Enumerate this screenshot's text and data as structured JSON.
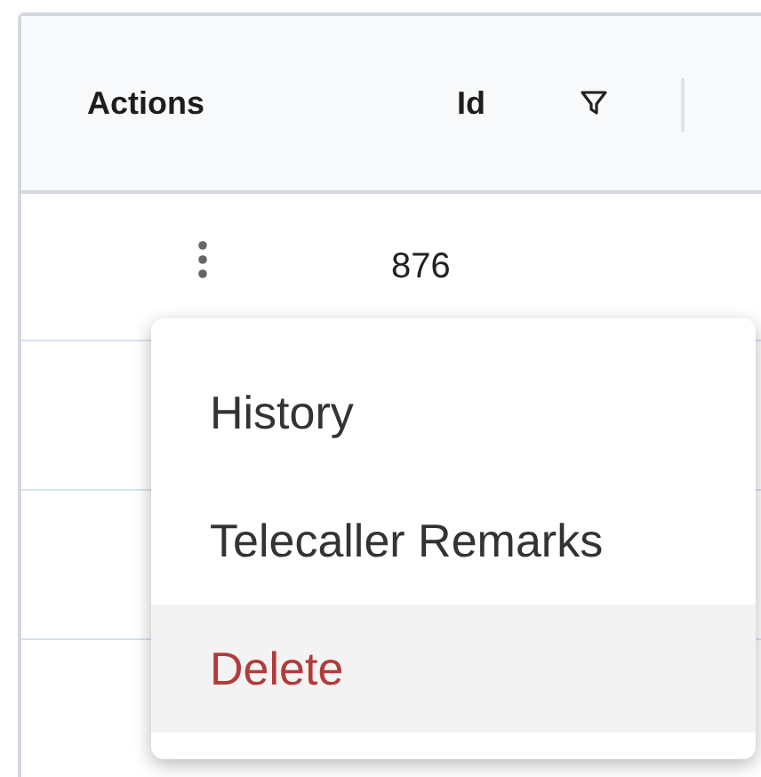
{
  "table": {
    "columns": [
      {
        "label": "Actions",
        "filter": false
      },
      {
        "label": "Id",
        "filter": true
      }
    ],
    "rows": [
      {
        "id": "876"
      }
    ]
  },
  "menu": {
    "items": [
      {
        "label": "History",
        "kind": "normal",
        "highlighted": false
      },
      {
        "label": "Telecaller Remarks",
        "kind": "normal",
        "highlighted": false
      },
      {
        "label": "Delete",
        "kind": "danger",
        "highlighted": true
      }
    ]
  }
}
